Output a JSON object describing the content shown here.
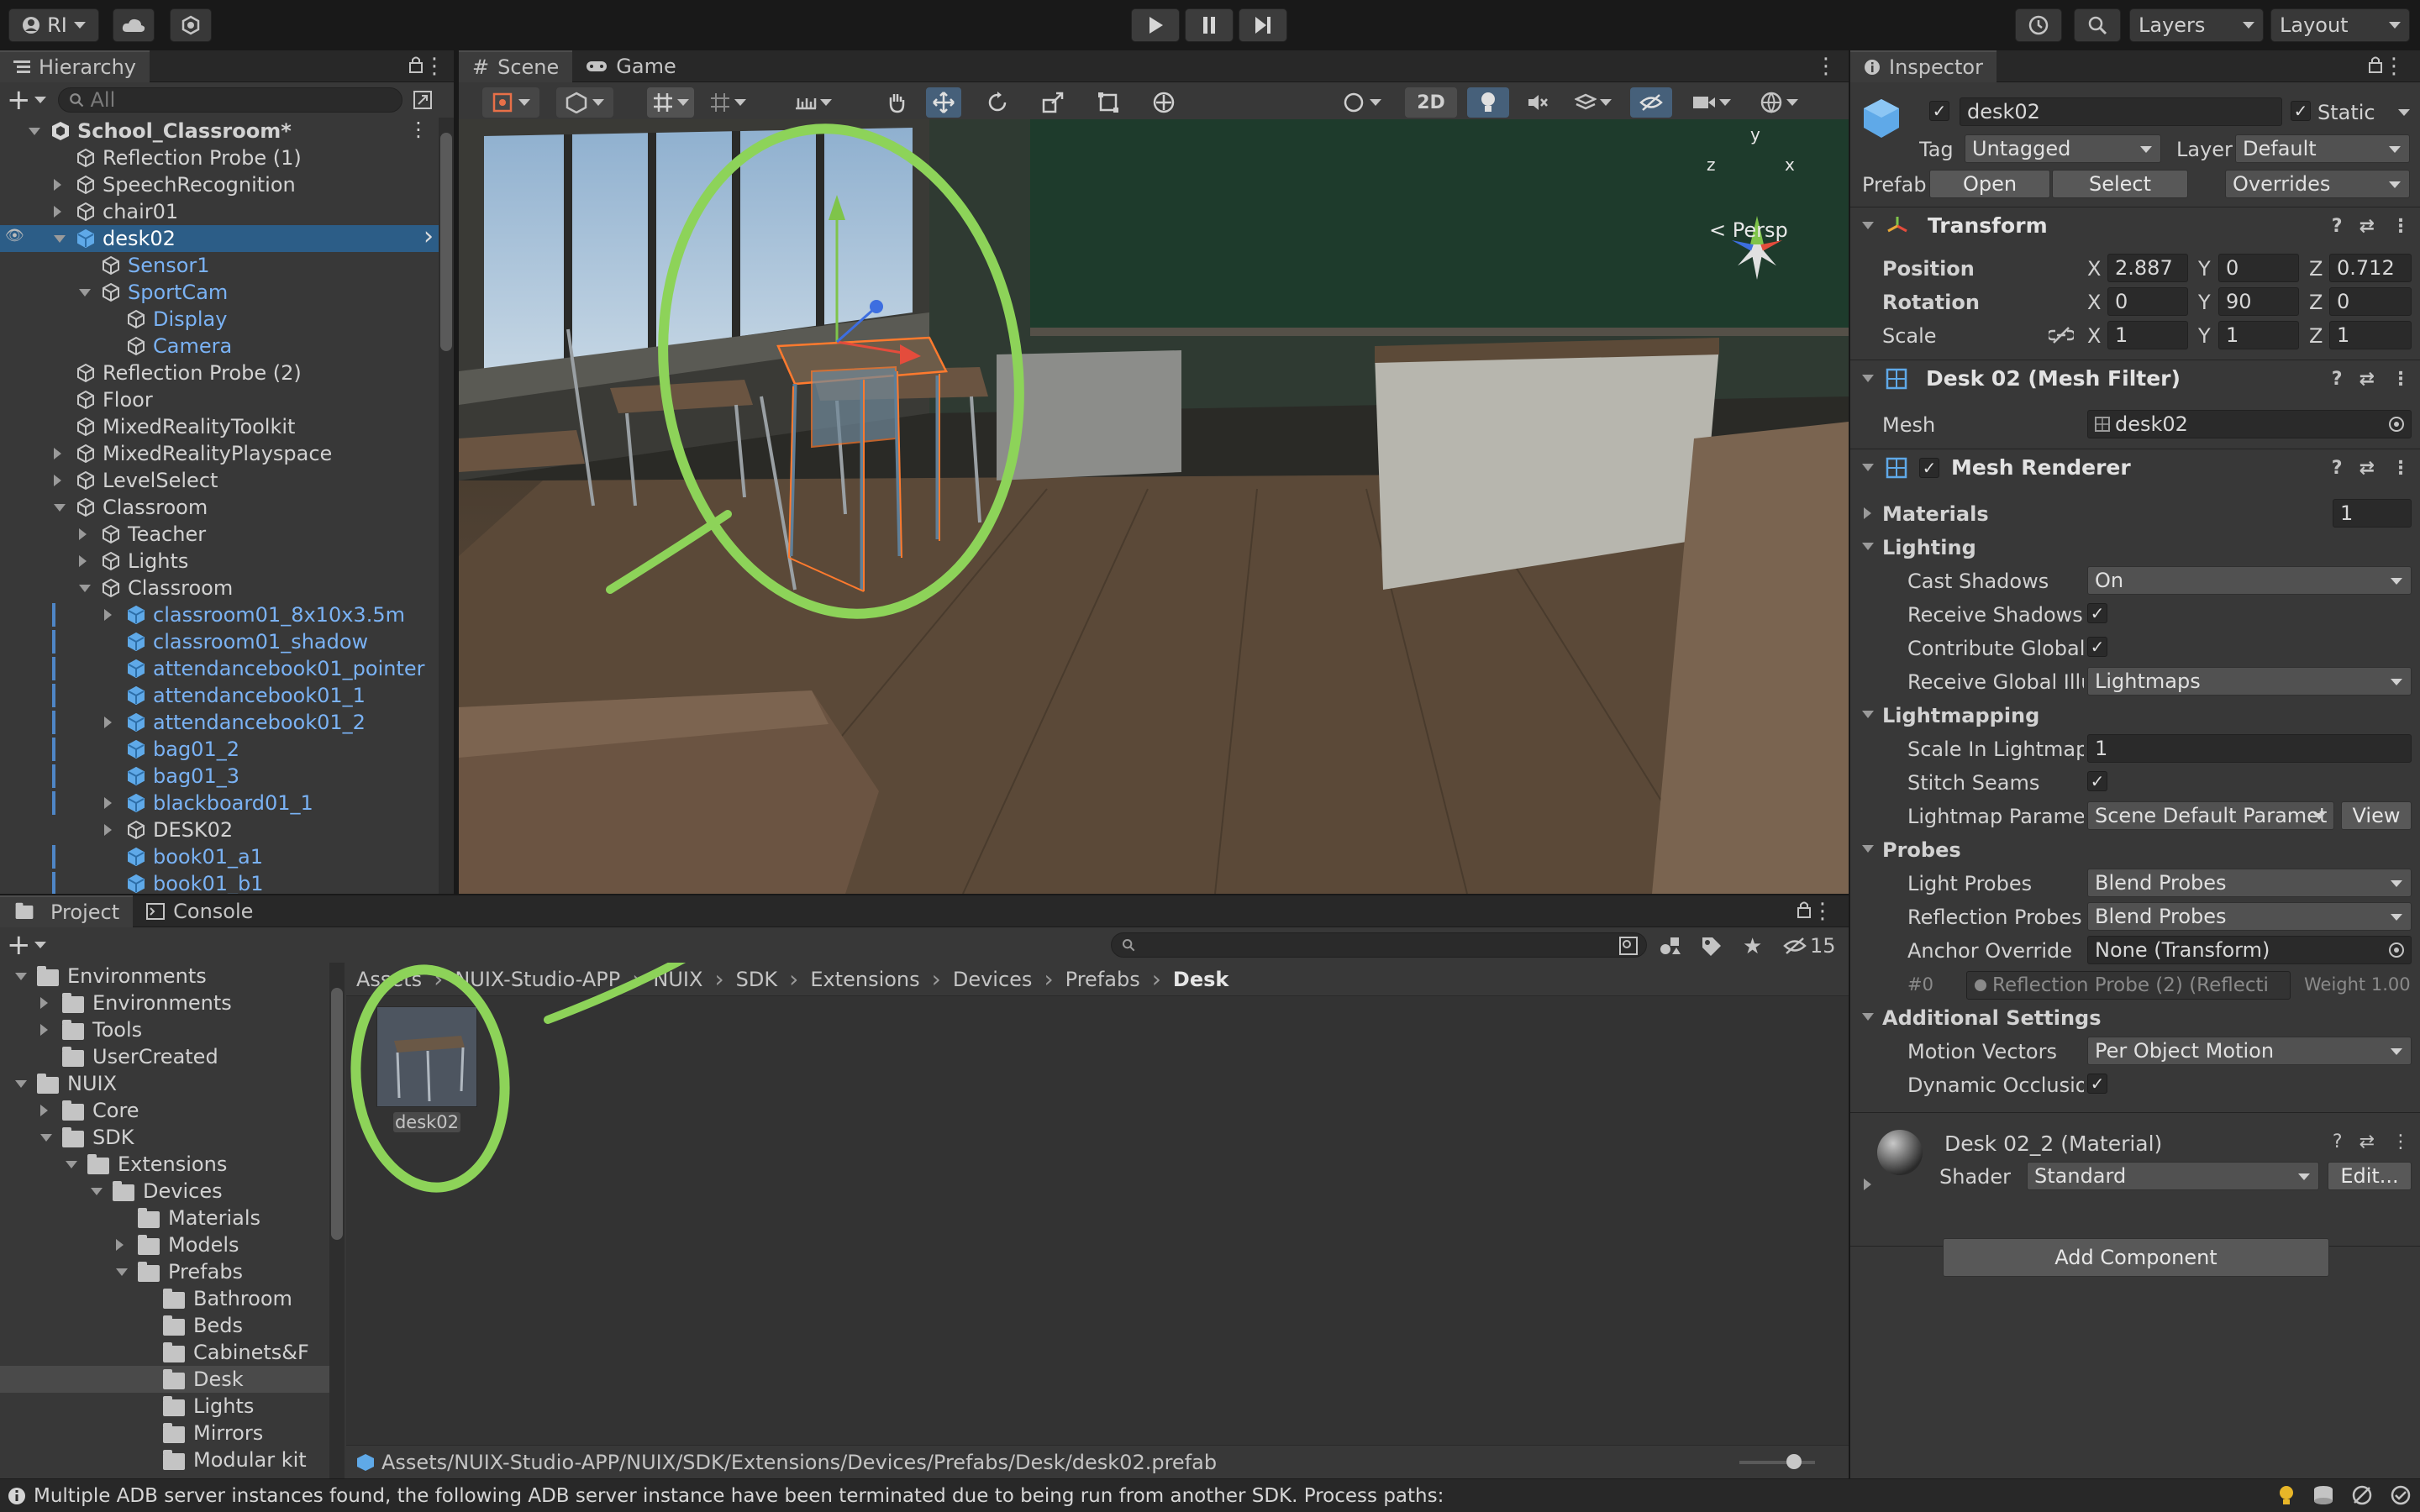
{
  "toolbar": {
    "account": "RI",
    "layers": "Layers",
    "layout": "Layout"
  },
  "hierarchy": {
    "title": "Hierarchy",
    "search_placeholder": "All",
    "items": [
      {
        "label": "School_Classroom*"
      },
      {
        "label": "Reflection Probe (1)"
      },
      {
        "label": "SpeechRecognition"
      },
      {
        "label": "chair01"
      },
      {
        "label": "desk02"
      },
      {
        "label": "Sensor1"
      },
      {
        "label": "SportCam"
      },
      {
        "label": "Display"
      },
      {
        "label": "Camera"
      },
      {
        "label": "Reflection Probe (2)"
      },
      {
        "label": "Floor"
      },
      {
        "label": "MixedRealityToolkit"
      },
      {
        "label": "MixedRealityPlayspace"
      },
      {
        "label": "LevelSelect"
      },
      {
        "label": "Classroom"
      },
      {
        "label": "Teacher"
      },
      {
        "label": "Lights"
      },
      {
        "label": "Classroom"
      },
      {
        "label": "classroom01_8x10x3.5m"
      },
      {
        "label": "classroom01_shadow"
      },
      {
        "label": "attendancebook01_pointer"
      },
      {
        "label": "attendancebook01_1"
      },
      {
        "label": "attendancebook01_2"
      },
      {
        "label": "bag01_2"
      },
      {
        "label": "bag01_3"
      },
      {
        "label": "blackboard01_1"
      },
      {
        "label": "DESK02"
      },
      {
        "label": "book01_a1"
      },
      {
        "label": "book01_b1"
      }
    ]
  },
  "scene": {
    "tab_scene": "Scene",
    "tab_game": "Game",
    "btn_2d": "2D",
    "persp": "Persp",
    "axis_x": "x",
    "axis_y": "y",
    "axis_z": "z"
  },
  "project": {
    "tab_project": "Project",
    "tab_console": "Console",
    "hidden_count": "15",
    "breadcrumb": [
      "Assets",
      "NUIX-Studio-APP",
      "NUIX",
      "SDK",
      "Extensions",
      "Devices",
      "Prefabs",
      "Desk"
    ],
    "tree": [
      {
        "label": "Environments"
      },
      {
        "label": "Environments"
      },
      {
        "label": "Tools"
      },
      {
        "label": "UserCreated"
      },
      {
        "label": "NUIX"
      },
      {
        "label": "Core"
      },
      {
        "label": "SDK"
      },
      {
        "label": "Extensions"
      },
      {
        "label": "Devices"
      },
      {
        "label": "Materials"
      },
      {
        "label": "Models"
      },
      {
        "label": "Prefabs"
      },
      {
        "label": "Bathroom"
      },
      {
        "label": "Beds"
      },
      {
        "label": "Cabinets&F"
      },
      {
        "label": "Desk"
      },
      {
        "label": "Lights"
      },
      {
        "label": "Mirrors"
      },
      {
        "label": "Modular kit"
      }
    ],
    "asset_label": "desk02",
    "path": "Assets/NUIX-Studio-APP/NUIX/SDK/Extensions/Devices/Prefabs/Desk/desk02.prefab"
  },
  "inspector": {
    "title": "Inspector",
    "object_name": "desk02",
    "static_label": "Static",
    "tag_label": "Tag",
    "tag_value": "Untagged",
    "layer_label": "Layer",
    "layer_value": "Default",
    "prefab_label": "Prefab",
    "prefab_open": "Open",
    "prefab_select": "Select",
    "prefab_overrides": "Overrides",
    "transform": {
      "title": "Transform",
      "position_label": "Position",
      "rotation_label": "Rotation",
      "scale_label": "Scale",
      "pos": {
        "x": "2.887",
        "y": "0",
        "z": "0.712"
      },
      "rot": {
        "x": "0",
        "y": "90",
        "z": "0"
      },
      "scale": {
        "x": "1",
        "y": "1",
        "z": "1"
      }
    },
    "mesh_filter": {
      "title": "Desk 02 (Mesh Filter)",
      "mesh_label": "Mesh",
      "mesh_value": "desk02"
    },
    "mesh_renderer": {
      "title": "Mesh Renderer",
      "materials_label": "Materials",
      "materials_count": "1",
      "lighting_label": "Lighting",
      "cast_shadows_label": "Cast Shadows",
      "cast_shadows_value": "On",
      "receive_shadows_label": "Receive Shadows",
      "contribute_gi_label": "Contribute Global I",
      "receive_gi_label": "Receive Global Illu",
      "receive_gi_value": "Lightmaps",
      "lightmapping_label": "Lightmapping",
      "scale_lightmap_label": "Scale In Lightmap",
      "scale_lightmap_value": "1",
      "stitch_seams_label": "Stitch Seams",
      "lightmap_params_label": "Lightmap Paramete",
      "lightmap_params_value": "Scene Default Paramet",
      "view_button": "View",
      "probes_label": "Probes",
      "light_probes_label": "Light Probes",
      "light_probes_value": "Blend Probes",
      "reflection_probes_label": "Reflection Probes",
      "reflection_probes_value": "Blend Probes",
      "anchor_override_label": "Anchor Override",
      "anchor_override_value": "None (Transform)",
      "probe_index": "#0",
      "probe_ref": "Reflection Probe (2) (Reflecti",
      "probe_weight": "Weight 1.00",
      "additional_label": "Additional Settings",
      "motion_vectors_label": "Motion Vectors",
      "motion_vectors_value": "Per Object Motion",
      "dynamic_occlusion_label": "Dynamic Occlusio"
    },
    "material": {
      "title": "Desk 02_2 (Material)",
      "shader_label": "Shader",
      "shader_value": "Standard",
      "edit_button": "Edit..."
    },
    "add_component": "Add Component"
  },
  "status": {
    "message": "Multiple ADB server instances found, the following ADB server instance have been terminated due to being run from another SDK. Process paths:"
  }
}
